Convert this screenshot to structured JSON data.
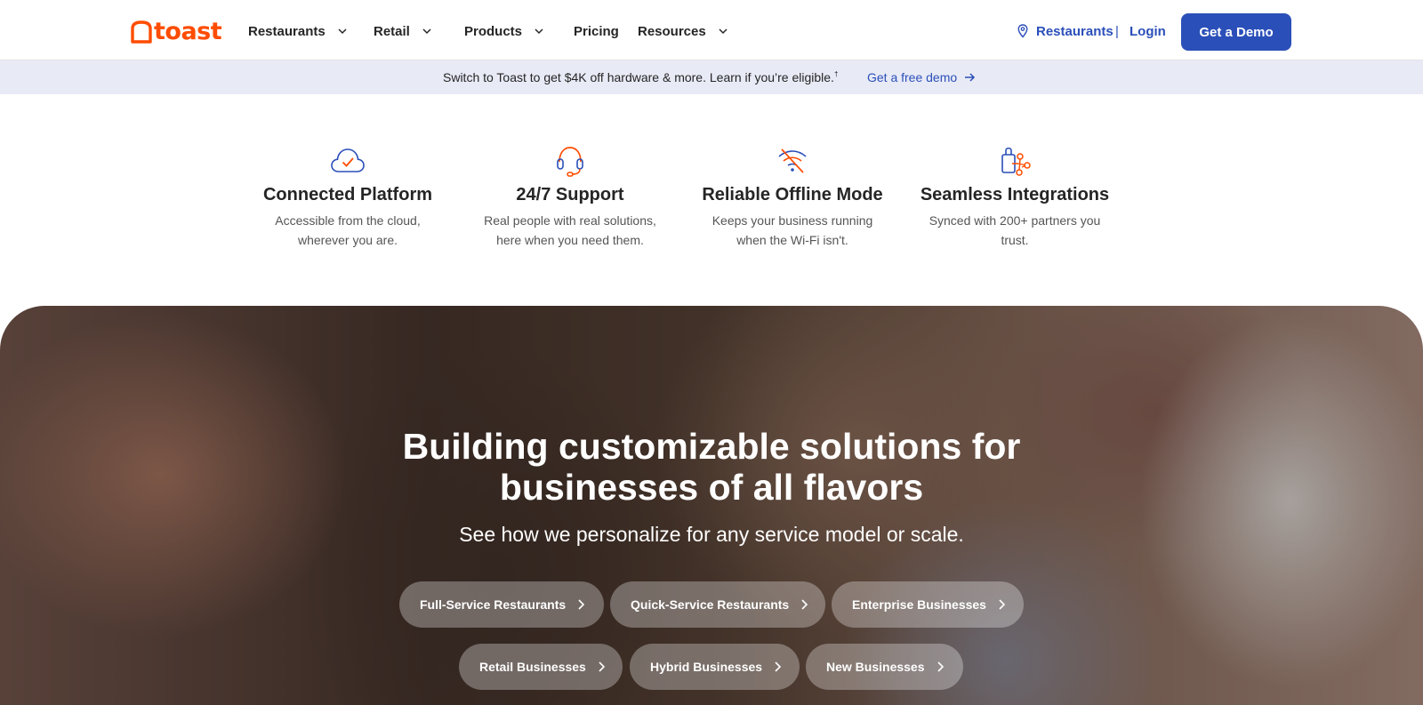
{
  "nav": {
    "logo_text": "toast",
    "items": [
      {
        "label": "Restaurants",
        "has_menu": true
      },
      {
        "label": "Retail",
        "has_menu": true
      },
      {
        "label": "Products",
        "has_menu": true
      },
      {
        "label": "Pricing",
        "has_menu": false
      },
      {
        "label": "Resources",
        "has_menu": true
      }
    ],
    "location_label": "Restaurants",
    "separator": "|",
    "login_label": "Login",
    "demo_button": "Get a Demo"
  },
  "banner": {
    "text": "Switch to Toast to get $4K off hardware & more. Learn if you’re eligible.",
    "footnote_mark": "†",
    "link": "Get a free demo"
  },
  "features": [
    {
      "icon": "cloud-check-icon",
      "title": "Connected Platform",
      "desc_line1": "Accessible from the cloud,",
      "desc_line2": "wherever you are."
    },
    {
      "icon": "headset-icon",
      "title": "24/7 Support",
      "desc_line1": "Real people with real solutions,",
      "desc_line2": "here when you need them."
    },
    {
      "icon": "wifi-off-icon",
      "title": "Reliable Offline Mode",
      "desc_line1": "Keeps your business running",
      "desc_line2": "when the Wi-Fi isn't."
    },
    {
      "icon": "integrations-icon",
      "title": "Seamless Integrations",
      "desc_line1": "Synced with 200+ partners you",
      "desc_line2": "trust."
    }
  ],
  "hero": {
    "title_line1": "Building customizable solutions for",
    "title_line2": "businesses of all flavors",
    "subtitle": "See how we personalize for any service model or scale.",
    "buttons": [
      "Full-Service Restaurants",
      "Quick-Service Restaurants",
      "Enterprise Businesses",
      "Retail Businesses",
      "Hybrid Businesses",
      "New Businesses"
    ]
  },
  "colors": {
    "brand_orange": "#ff4c00",
    "primary_blue": "#2b4fb9",
    "banner_bg": "#e8eaf6"
  }
}
